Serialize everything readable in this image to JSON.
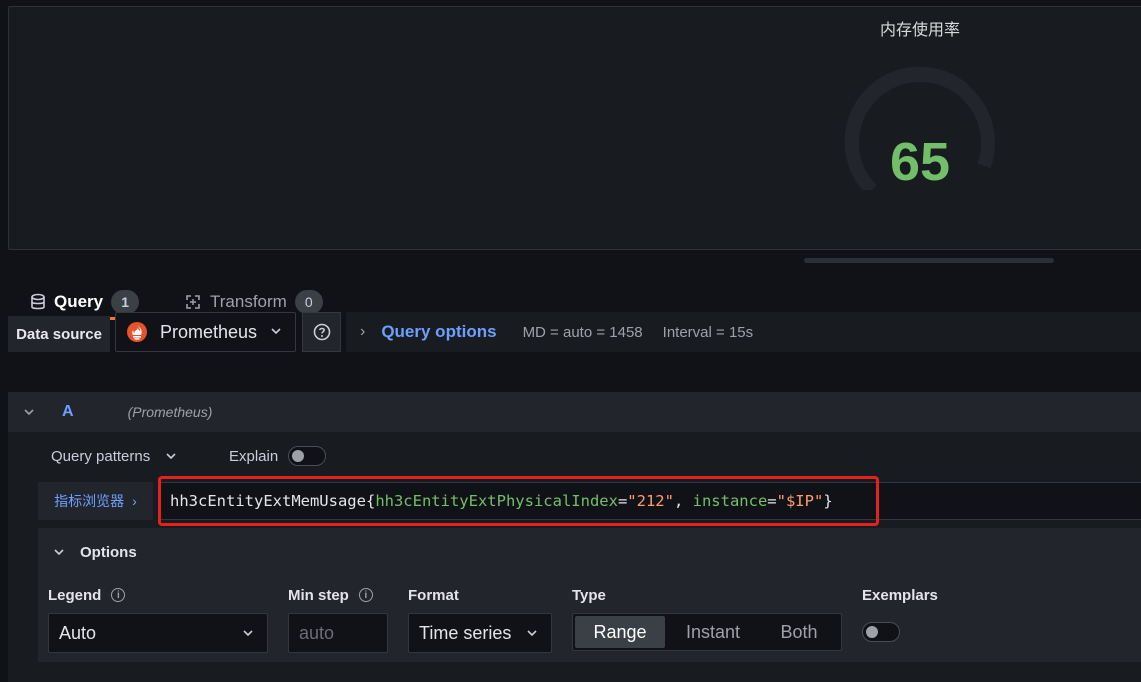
{
  "panel": {
    "title": "内存使用率",
    "gauge_value": "65",
    "gauge_fraction": 0.65,
    "gauge_color": "#73bf69"
  },
  "tabs": [
    {
      "label": "Query",
      "count": "1",
      "icon": "database-icon"
    },
    {
      "label": "Transform",
      "count": "0",
      "icon": "transform-icon"
    }
  ],
  "datasource": {
    "label": "Data source",
    "selected": "Prometheus",
    "icon": "prometheus-icon"
  },
  "query_options": {
    "label": "Query options",
    "md": "MD = auto = 1458",
    "interval": "Interval = 15s"
  },
  "query_a": {
    "ref": "A",
    "source": "(Prometheus)",
    "patterns_label": "Query patterns",
    "explain_label": "Explain",
    "metrics_browser": "指标浏览器",
    "expr": {
      "metric": "hh3cEntityExtMemUsage",
      "open": "{",
      "label1": "hh3cEntityExtPhysicalIndex",
      "eq1": "=",
      "val1": "\"212\"",
      "sep": ", ",
      "label2": "instance",
      "eq2": "=",
      "val2": "\"$IP\"",
      "close": "}"
    }
  },
  "options": {
    "header": "Options",
    "legend_label": "Legend",
    "legend_value": "Auto",
    "minstep_label": "Min step",
    "minstep_placeholder": "auto",
    "format_label": "Format",
    "format_value": "Time series",
    "type_label": "Type",
    "type_options": [
      "Range",
      "Instant",
      "Both"
    ],
    "type_selected": "Range",
    "exemplars_label": "Exemplars"
  },
  "colors": {
    "accent_blue": "#6e9fff",
    "tab_underline": "#f5743b",
    "highlight_box": "#e3221e"
  }
}
